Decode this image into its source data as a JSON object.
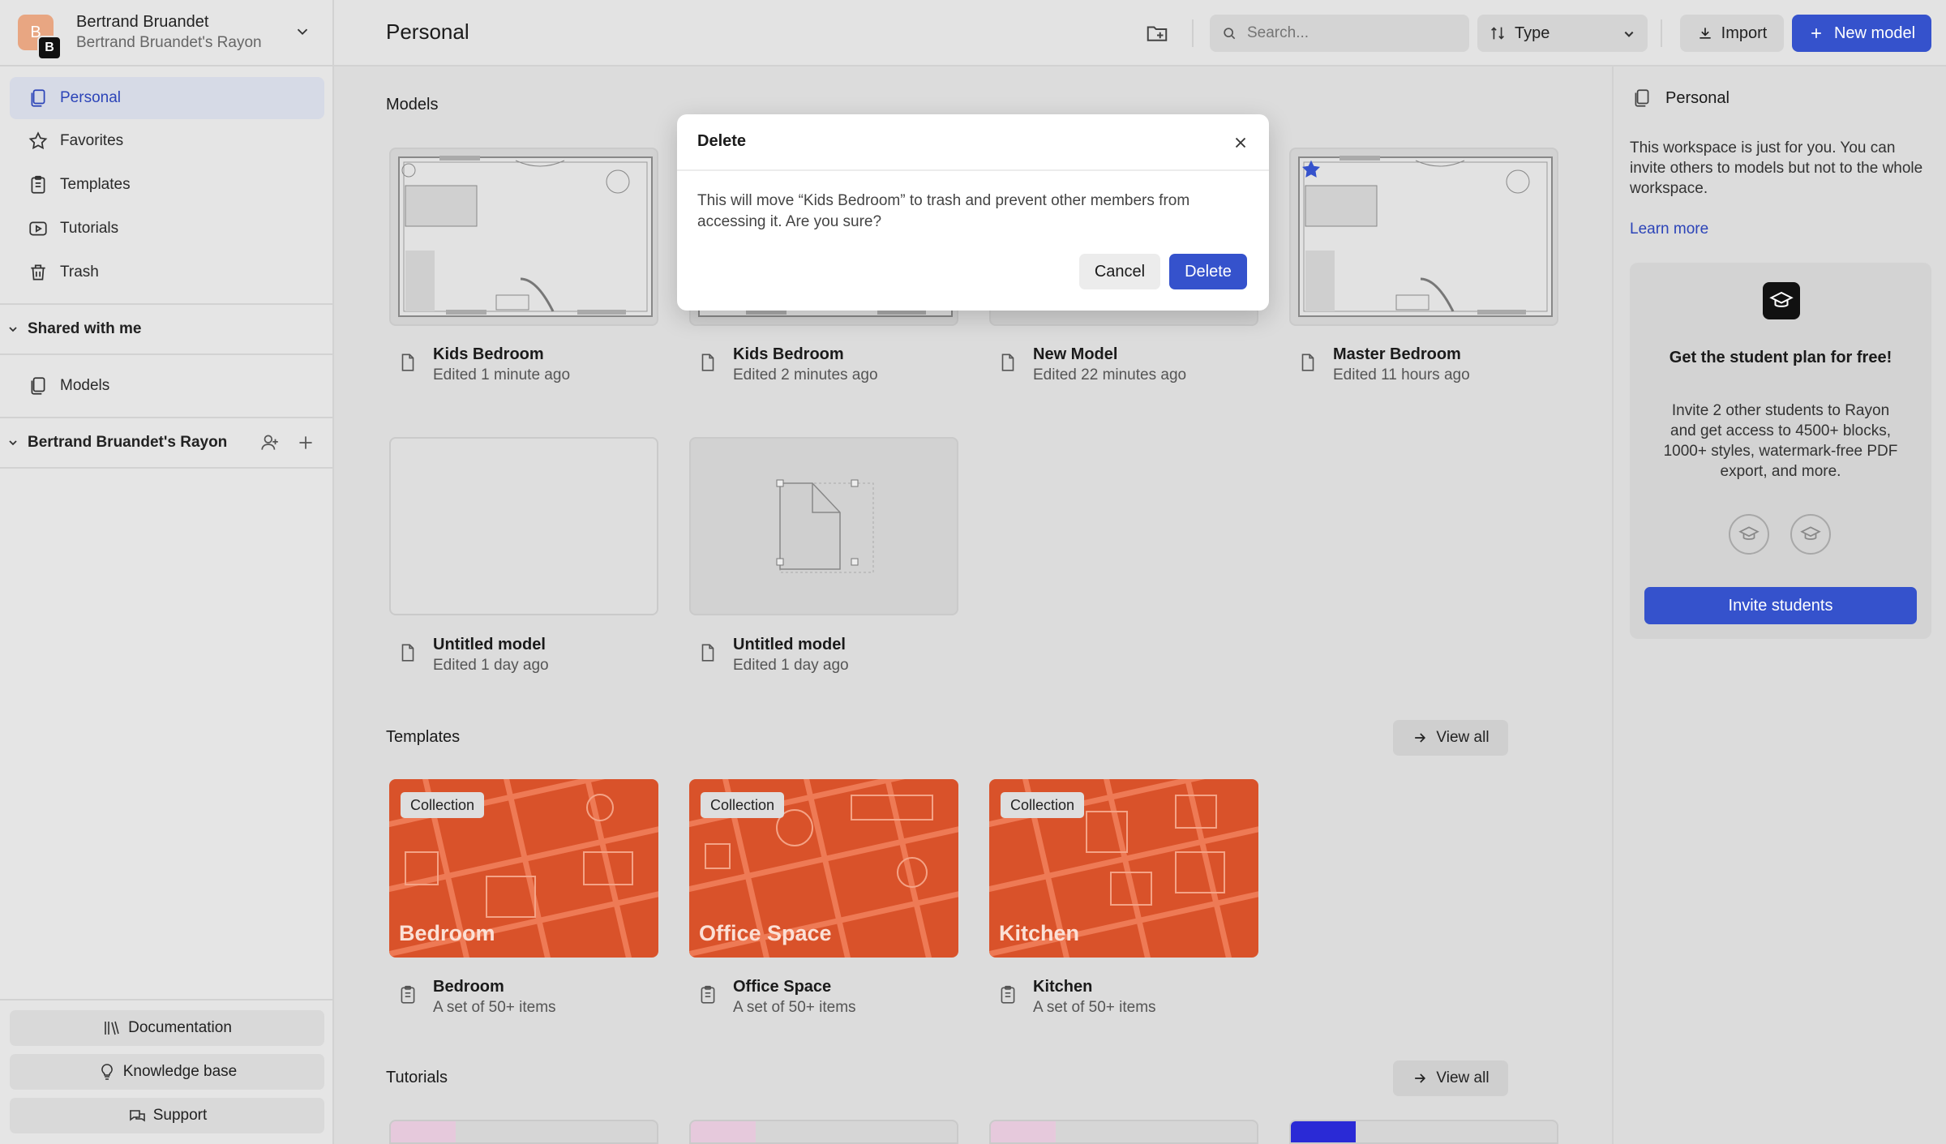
{
  "account": {
    "initial": "B",
    "badge": "B",
    "name": "Bertrand Bruandet",
    "workspace": "Bertrand Bruandet's Rayon"
  },
  "sidebar": {
    "items": [
      {
        "label": "Personal",
        "icon": "pages-icon"
      },
      {
        "label": "Favorites",
        "icon": "star-icon"
      },
      {
        "label": "Templates",
        "icon": "clipboard-icon"
      },
      {
        "label": "Tutorials",
        "icon": "play-icon"
      },
      {
        "label": "Trash",
        "icon": "trash-icon"
      }
    ],
    "shared_label": "Shared with me",
    "shared_items": [
      {
        "label": "Models",
        "icon": "pages-icon"
      }
    ],
    "workspace_label": "Bertrand Bruandet's Rayon",
    "bottom": [
      {
        "label": "Documentation",
        "icon": "books-icon"
      },
      {
        "label": "Knowledge base",
        "icon": "bulb-icon"
      },
      {
        "label": "Support",
        "icon": "chat-icon"
      }
    ]
  },
  "topbar": {
    "title": "Personal",
    "search_placeholder": "Search...",
    "type_label": "Type",
    "import_label": "Import",
    "new_model_label": "New model"
  },
  "main": {
    "models_title": "Models",
    "models": [
      {
        "title": "Kids Bedroom",
        "sub": "Edited 1 minute ago"
      },
      {
        "title": "Kids Bedroom",
        "sub": "Edited 2 minutes ago"
      },
      {
        "title": "New Model",
        "sub": "Edited 22 minutes ago"
      },
      {
        "title": "Master Bedroom",
        "sub": "Edited 11 hours ago",
        "favorite": true
      },
      {
        "title": "Untitled model",
        "sub": "Edited 1 day ago"
      },
      {
        "title": "Untitled model",
        "sub": "Edited 1 day ago"
      }
    ],
    "templates_title": "Templates",
    "view_all": "View all",
    "templates": [
      {
        "tag": "Collection",
        "banner": "Bedroom",
        "title": "Bedroom",
        "sub": "A set of 50+ items"
      },
      {
        "tag": "Collection",
        "banner": "Office Space",
        "title": "Office Space",
        "sub": "A set of 50+ items"
      },
      {
        "tag": "Collection",
        "banner": "Kitchen",
        "title": "Kitchen",
        "sub": "A set of 50+ items"
      }
    ],
    "tutorials_title": "Tutorials"
  },
  "right_panel": {
    "title": "Personal",
    "description": "This workspace is just for you. You can invite others to models but not to the whole workspace.",
    "learn_more": "Learn more",
    "promo_title": "Get the student plan for free!",
    "promo_text": "Invite 2 other students to Rayon and get access to 4500+ blocks, 1000+ styles, watermark-free PDF export, and more.",
    "invite_label": "Invite students"
  },
  "modal": {
    "title": "Delete",
    "body": "This will move “Kids Bedroom” to trash and prevent other members from accessing it. Are you sure?",
    "cancel": "Cancel",
    "confirm": "Delete"
  },
  "colors": {
    "accent": "#3552cc",
    "template_bg": "#d9522a",
    "active_nav_bg": "#d6dae6"
  }
}
